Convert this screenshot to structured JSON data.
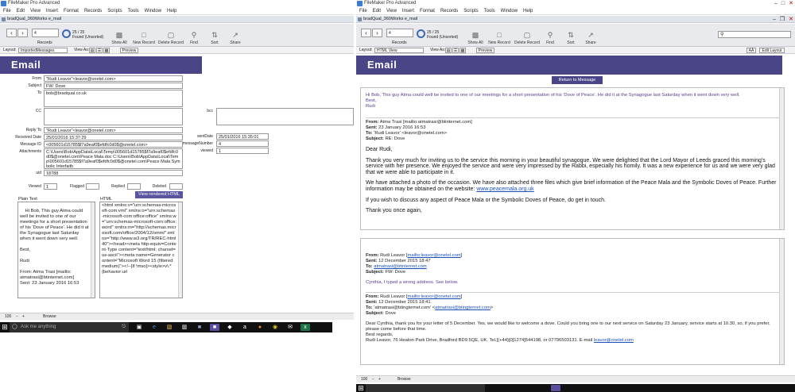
{
  "left": {
    "window_title": "FileMaker Pro Advanced",
    "menu": [
      "File",
      "Edit",
      "View",
      "Insert",
      "Format",
      "Records",
      "Scripts",
      "Tools",
      "Window",
      "Help"
    ],
    "doc_tab": "bradQual_360Works e_mail",
    "toolbar": {
      "record_number": "4",
      "found_count": "25 / 25",
      "found_state": "Found (Unsorted)",
      "records_label": "Records",
      "tools": [
        "Show All",
        "New Record",
        "Delete Record",
        "Find",
        "Sort",
        "Share"
      ]
    },
    "layout_bar": {
      "layout_label": "Layout:",
      "layout_value": "ImportedMessages",
      "view_as": "View As:",
      "preview": "Preview"
    },
    "header_title": "Email",
    "fields": {
      "from_label": "From",
      "from": "\"Rudi Leavor\"<leavor@onetel.com>",
      "subject_label": "Subject",
      "subject": "FW: Dove",
      "to_label": "To",
      "to": "bob@bradqual.co.uk",
      "cc_label": "CC",
      "cc": "",
      "bcc_label": "bcc",
      "replyto_label": "Reply To",
      "replyto": "\"Rudi Leavor\"<leavor@onetel.com>",
      "received_label": "Received Date",
      "received": "25/01/2016 15:37:29",
      "messageid_label": "Message ID",
      "messageid": "<005601d15785$f7a9eaf0$efdfc0d0$@onetel.com>",
      "attachments_label": "Attachments",
      "attachments": "C:\\Users\\Bob\\AppData\\Local\\Temp\\005601d15785$f7a9eaf0$efdfc0d0$@onetel.com\\Peace Mala.doc C:\\Users\\Bob\\AppData\\Local\\Temp\\005601d15785$f7a9eaf0$efdfc0d0$@onetel.com\\Peace Mala Symbolic Interfaith",
      "uid_label": "uid",
      "uid": "18788",
      "sentdate_label": "sentDate",
      "sentdate": "25/01/2016 15:35:01",
      "messagenumber_label": "messageNumber",
      "messagenumber": "4",
      "viewed_label": "viewed",
      "viewed": "1",
      "viewed2_label": "Viewed",
      "viewed2": "1",
      "flagged_label": "Flagged",
      "replied_label": "Replied",
      "deleted_label": "Deleted"
    },
    "plain_text_label": "Plain Text",
    "html_label": "HTML",
    "view_rendered_button": "View rendered HTML",
    "plain_text": "Hi Bob, This guy Atma could well be invited to one of our meetings for a short presentation of his 'Dove of Peace'. He did it at the Synagogue last Saturday when it went down very well.\n\nBest,\n\nRudi\n\nFrom: Atma Trasi [mailto: atmatrasi@btinternet.com]\nSent: 23 January 2016 16:53",
    "html_text": "<html xmlns:v=\"urn:schemas-microsoft-com:vml\" xmlns:o=\"urn:schemas-microsoft-com:office:office\" xmlns:w=\"urn:schemas-microsoft-com:office:word\" xmlns:m=\"http://schemas.microsoft.com/office/2004/12/omml\" xmlns=\"http://www.w3.org/TR/REC-html40\"><head><meta http-equiv=Content-Type content=\"text/html; charset=us-ascii\"><meta name=Generator content=\"Microsoft Word 15 (filtered medium)\"><!--[if !mso]><style>v\\:* {behavior:url",
    "status": {
      "zoom": "100",
      "mode": "Browse"
    },
    "taskbar_search": "Ask me anything"
  },
  "right": {
    "window_title": "FileMaker Pro Advanced",
    "menu": [
      "File",
      "Edit",
      "View",
      "Insert",
      "Format",
      "Records",
      "Scripts",
      "Tools",
      "Window",
      "Help"
    ],
    "doc_tab": "bradQual_360Works e_mail",
    "toolbar": {
      "record_number": "4",
      "found_count": "25 / 25",
      "found_state": "Found (Unsorted)",
      "records_label": "Records",
      "tools": [
        "Show All",
        "New Record",
        "Delete Record",
        "Find",
        "Sort",
        "Share"
      ]
    },
    "layout_bar": {
      "layout_label": "Layout:",
      "layout_value": "HTML View",
      "view_as": "View As:",
      "preview": "Preview",
      "aa": "AÂ",
      "edit_layout": "Edit Layout"
    },
    "header_title": "Email",
    "return_button": "Return to Message",
    "msg_intro": "Hi Bob, This guy Atma could well be invited to one of our meetings for a short presentation of his 'Dove of Peace'. He did it at the Synagogue last Saturday when it went down very well.",
    "msg_best": "Best,",
    "msg_rudi": "Rudi",
    "from1_label": "From:",
    "from1": "Atma Trasi [mailto:atmatrasi@btinternet.com]",
    "sent1_label": "Sent:",
    "sent1": "23 January 2016 16:53",
    "to1_label": "To:",
    "to1": "'Rudi Leavor' <leavor@onetel.com>",
    "subj1_label": "Subject:",
    "subj1": "RE: Dove",
    "dear_rudi": "Dear Rudi,",
    "para1": "Thank you very much for inviting us to the service this morning in your beautiful synagogue.  We were delighted that the Lord Mayor of Leeds graced this morning's service with her presence.  We enjoyed the service and were very impressed by the Rabbi, especially his homily.  It was a new experience for us and we were very glad that we were able to participate in it.",
    "para2": "We have attached a photo of the occasion.  We have also attached three files which give brief information of the Peace Mala and the Symbolic Doves of Peace. Further information may be obtained on the website: ",
    "para2_link": "www.peacemala.org.uk",
    "para3": "If you wish to discuss any aspect of Peace Mala or the Symbolic Doves of Peace, do get in touch.",
    "para4": "Thank you once again,",
    "from2_label": "From:",
    "from2": "Rudi Leavor [",
    "from2_link": "mailto:leavor@onetel.com",
    "from2_end": "]",
    "sent2_label": "Sent:",
    "sent2": "12 December 2015 18:47",
    "to2_label": "To:",
    "to2_link": "atmatrasi@btinternet.com",
    "subj2_label": "Subject:",
    "subj2": "FW: Dove",
    "cynthia_note": "Cynthia, I typed a wrong address. See below.",
    "from3_label": "From:",
    "from3": "Rudi Leavor [",
    "from3_link": "mailto:leavor@onetel.com",
    "from3_end": "]",
    "sent3_label": "Sent:",
    "sent3": "12 December 2015 18:41",
    "to3_label": "To:",
    "to3": "'atmatrasi@btingternet.com' <",
    "to3_link": "atmatrasi@btingternet.com",
    "to3_end": ">",
    "subj3_label": "Subject:",
    "subj3": "Dove",
    "dear_cynthia": "Dear Cynthia, thank you for your letter of 5 December. Yes, we would like to welcome a dove. Could you bring one to our next service on Saturday 23 January, service starts at 10.30, so, if you prefer, please come before that time.",
    "best_regards": "Best regards,",
    "signature": "Rudi Leavor, 76 Heaton Park Drive, Bradford BD9 5QE, UK. Tel.[(+44)[0]1274]544198, or 07796503131.       E-mail   ",
    "signature_link": "leavor@onetel.com",
    "status": {
      "zoom": "100",
      "mode": "Browse"
    }
  },
  "colors": {
    "header": "#4a4587",
    "link": "#1a4fb8",
    "taskbar": "#111111"
  }
}
